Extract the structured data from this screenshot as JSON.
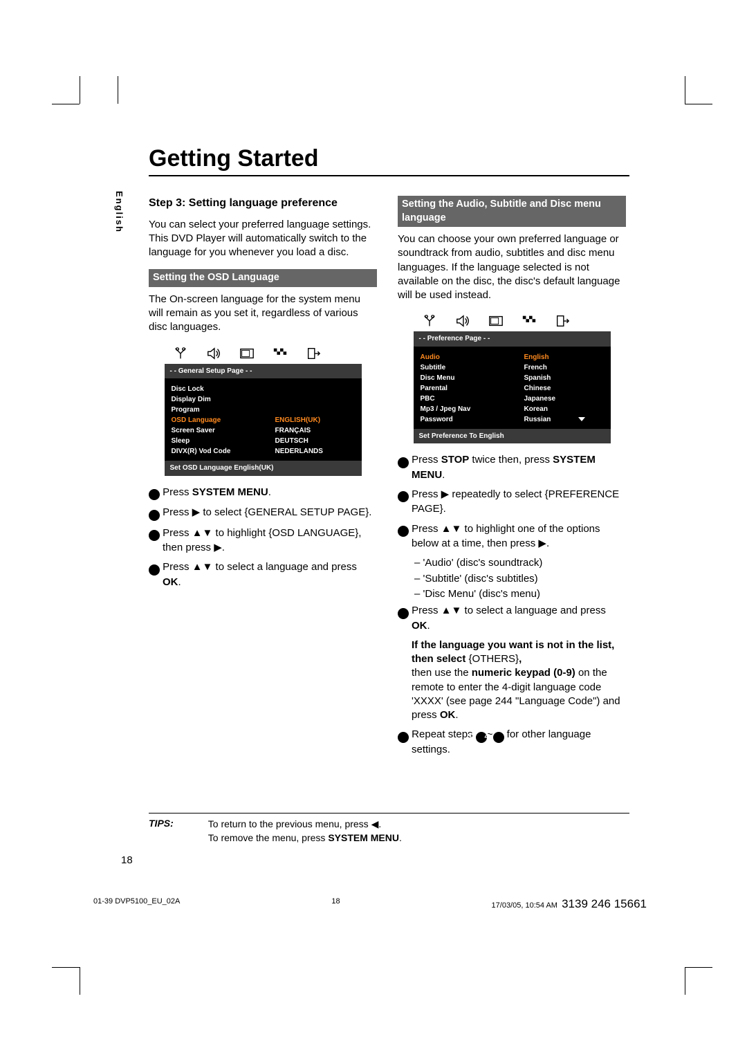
{
  "page": {
    "title": "Getting Started",
    "lang_tab": "English",
    "number": "18"
  },
  "left": {
    "step_heading": "Step 3:  Setting language preference",
    "intro": "You can select your preferred language settings. This DVD Player will automatically switch to the language for you whenever you load a disc.",
    "section_bar": "Setting the OSD Language",
    "para1": "The On-screen language for the system menu will remain as you set it, regardless of various disc languages.",
    "osd": {
      "title": "- -   General Setup Page   - -",
      "rows_left": [
        "Disc Lock",
        "Display Dim",
        "Program",
        "OSD Language",
        "Screen Saver",
        "Sleep",
        "DIVX(R) Vod Code"
      ],
      "rows_right": [
        "",
        "",
        "",
        "ENGLISH(UK)",
        "FRANÇAIS",
        "DEUTSCH",
        "NEDERLANDS"
      ],
      "highlight_index": 3,
      "footer": "Set OSD Language English(UK)"
    },
    "steps": {
      "s1": "Press SYSTEM MENU.",
      "s2": "Press ▶ to select {GENERAL SETUP PAGE}.",
      "s3": "Press ▲▼ to highlight {OSD LANGUAGE}, then press ▶.",
      "s4": "Press ▲▼ to select a language and press OK."
    }
  },
  "right": {
    "section_bar": "Setting the Audio, Subtitle and Disc menu language",
    "intro": "You can choose your own preferred language or soundtrack from audio, subtitles and disc menu languages. If the language selected is not available on the disc, the disc's default language will be used instead.",
    "osd": {
      "title": "- -   Preference Page   - -",
      "rows_left": [
        "Audio",
        "Subtitle",
        "Disc Menu",
        "Parental",
        "PBC",
        "Mp3 / Jpeg Nav",
        "Password"
      ],
      "rows_right": [
        "English",
        "French",
        "Spanish",
        "Chinese",
        "Japanese",
        "Korean",
        "Russian"
      ],
      "highlight_left": 0,
      "highlight_right": 0,
      "footer": "Set Preference To English"
    },
    "steps": {
      "s1_a": "Press ",
      "s1_b": "STOP",
      "s1_c": " twice then, press ",
      "s1_d": "SYSTEM MENU",
      "s1_e": ".",
      "s2": "Press ▶ repeatedly to select {PREFERENCE PAGE}.",
      "s3": "Press ▲▼ to highlight one of the options below at a time, then press ▶.",
      "s3a": "– 'Audio' (disc's soundtrack)",
      "s3b": "– 'Subtitle' (disc's subtitles)",
      "s3c": "– 'Disc Menu' (disc's menu)",
      "s4": "Press ▲▼ to select a language and press OK.",
      "note_a": "If the language you want is not in the list, then select ",
      "note_b": "{OTHERS}",
      "note_c": ",",
      "note2_a": "then use the ",
      "note2_b": "numeric keypad (0-9)",
      "note2_c": " on the remote to enter the 4-digit language code 'XXXX' (see page 244 \"Language Code\") and press ",
      "note2_d": "OK",
      "note2_e": ".",
      "s5_a": "Repeat steps ",
      "s5_b": "~",
      "s5_c": " for other language settings."
    }
  },
  "tips": {
    "label": "TIPS:",
    "line1": "To return to the previous menu, press ◀.",
    "line2_a": "To remove the menu, press ",
    "line2_b": "SYSTEM MENU",
    "line2_c": "."
  },
  "footer": {
    "left": "01-39 DVP5100_EU_02A",
    "mid": "18",
    "right_a": "17/03/05, 10:54 AM",
    "right_b": "3139 246 15661"
  }
}
